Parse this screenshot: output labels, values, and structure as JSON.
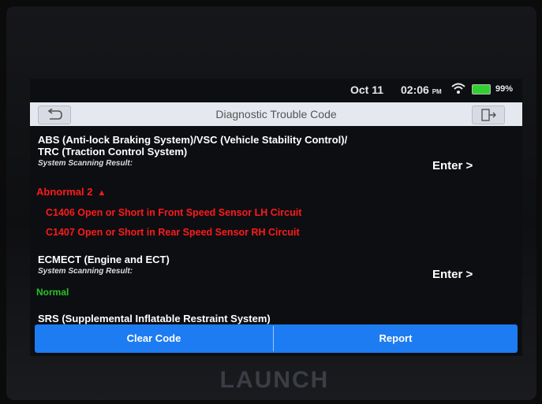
{
  "status_bar": {
    "date": "Oct 11",
    "time": "02:06",
    "ampm": "PM",
    "battery": "99%",
    "battery_fill": 0.99,
    "wifi_icon": "wifi-icon"
  },
  "title_bar": {
    "title": "Diagnostic Trouble Code",
    "back_icon": "back-arrow-icon",
    "exit_icon": "exit-icon"
  },
  "systems": [
    {
      "name_line1": "ABS (Anti-lock Braking System)/VSC (Vehicle Stability Control)/",
      "name_line2": "TRC (Traction Control System)",
      "scan_label": "System Scanning Result:",
      "result": "Abnormal 2",
      "result_color": "#ff1a1a",
      "enter_label": "Enter >",
      "codes": [
        "C1406 Open or Short in Front Speed Sensor LH Circuit",
        "C1407 Open or Short in Rear Speed Sensor RH Circuit"
      ]
    },
    {
      "name_line1": "ECMECT (Engine and ECT)",
      "scan_label": "System Scanning Result:",
      "result": "Normal",
      "result_color": "#27c227",
      "enter_label": "Enter >"
    },
    {
      "name_line1": "SRS (Supplemental Inflatable Restraint System)"
    }
  ],
  "buttons": {
    "clear_code": "Clear Code",
    "report": "Report"
  },
  "device": {
    "logo": "LAUNCH"
  },
  "colors": {
    "button_blue": "#1d7cf2",
    "title_bar": "#e6e8ef"
  }
}
